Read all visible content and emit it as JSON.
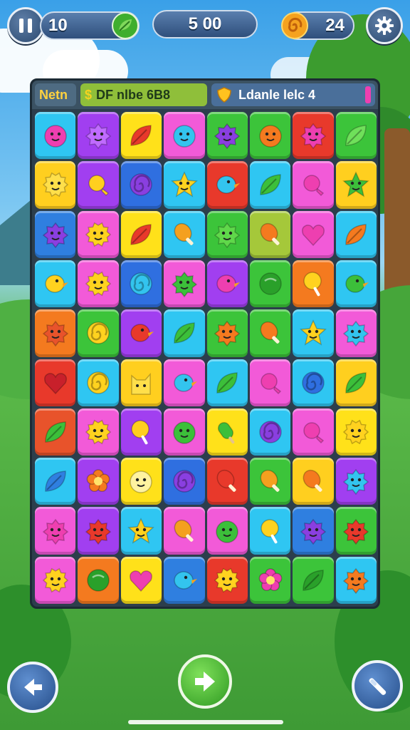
{
  "hud": {
    "moves": "10",
    "score": "5 00",
    "coins": "24"
  },
  "board_header": {
    "left_label": "Netn",
    "mid_label": "DF nlbe 6B8",
    "right_label": "Ldanle lelc 4"
  },
  "colors": {
    "red": "#e8392b",
    "orange": "#f47a1f",
    "yellow": "#ffd21f",
    "green": "#3cbf3a",
    "lime": "#8fd23a",
    "blue": "#2f7fe0",
    "cyan": "#33c4ee",
    "purple": "#8a3fe0",
    "pink": "#ee3fb0",
    "magenta": "#c83fe8"
  },
  "grid": [
    [
      {
        "color": "#2fc6f2",
        "icon": "blob-monster-icon",
        "ic": "#ee3fb0"
      },
      {
        "color": "#a13ff0",
        "icon": "spiky-monster-icon",
        "ic": "#c06bff"
      },
      {
        "color": "#ffe11a",
        "icon": "leaf-icon",
        "ic": "#e8392b"
      },
      {
        "color": "#f25ad8",
        "icon": "blob-monster-icon",
        "ic": "#33c4ee"
      },
      {
        "color": "#3cc43a",
        "icon": "spiky-monster-icon",
        "ic": "#8a3fe0"
      },
      {
        "color": "#3cc43a",
        "icon": "blob-monster-icon",
        "ic": "#f47a1f"
      },
      {
        "color": "#e8392b",
        "icon": "spiky-monster-icon",
        "ic": "#ee3fb0"
      },
      {
        "color": "#3cc43a",
        "icon": "leaf-icon",
        "ic": "#6fe05a"
      }
    ],
    [
      {
        "color": "#ffcf1f",
        "icon": "sun-icon",
        "ic": "#ffdf4a"
      },
      {
        "color": "#a13ff0",
        "icon": "candy-icon",
        "ic": "#ffcf1f"
      },
      {
        "color": "#2f6fe0",
        "icon": "swirl-icon",
        "ic": "#8a3fe0"
      },
      {
        "color": "#2fc6f2",
        "icon": "star-monster-icon",
        "ic": "#ffd21f"
      },
      {
        "color": "#e8392b",
        "icon": "bird-icon",
        "ic": "#33c4ee"
      },
      {
        "color": "#2fc6f2",
        "icon": "leaf-icon",
        "ic": "#3cbf3a"
      },
      {
        "color": "#f25ad8",
        "icon": "candy-icon",
        "ic": "#ee3fb0"
      },
      {
        "color": "#ffcf1f",
        "icon": "star-monster-icon",
        "ic": "#3cbf3a"
      }
    ],
    [
      {
        "color": "#2f7fe0",
        "icon": "spiky-monster-icon",
        "ic": "#8a3fe0"
      },
      {
        "color": "#f25ad8",
        "icon": "sun-icon",
        "ic": "#ffd21f"
      },
      {
        "color": "#ffe11a",
        "icon": "leaf-icon",
        "ic": "#e8392b"
      },
      {
        "color": "#2fc6f2",
        "icon": "drumstick-icon",
        "ic": "#f4a01f"
      },
      {
        "color": "#3cc43a",
        "icon": "spiky-monster-icon",
        "ic": "#5fd84a"
      },
      {
        "color": "#a5c83a",
        "icon": "drumstick-icon",
        "ic": "#f47a1f"
      },
      {
        "color": "#f25ad8",
        "icon": "heart-icon",
        "ic": "#ee3fb0"
      },
      {
        "color": "#2fc6f2",
        "icon": "leaf-icon",
        "ic": "#f47a1f"
      }
    ],
    [
      {
        "color": "#2fc6f2",
        "icon": "bird-icon",
        "ic": "#ffd21f"
      },
      {
        "color": "#f25ad8",
        "icon": "sun-icon",
        "ic": "#ffd21f"
      },
      {
        "color": "#2f6fe0",
        "icon": "swirl-icon",
        "ic": "#33c4ee"
      },
      {
        "color": "#f25ad8",
        "icon": "spiky-monster-icon",
        "ic": "#3cbf3a"
      },
      {
        "color": "#a13ff0",
        "icon": "bird-icon",
        "ic": "#ee3fb0"
      },
      {
        "color": "#3cc43a",
        "icon": "round-candy-icon",
        "ic": "#2aa02a"
      },
      {
        "color": "#f47a1f",
        "icon": "lollipop-icon",
        "ic": "#ffd21f"
      },
      {
        "color": "#2fc6f2",
        "icon": "bird-icon",
        "ic": "#3cbf3a"
      }
    ],
    [
      {
        "color": "#f47a1f",
        "icon": "spiky-monster-icon",
        "ic": "#e8532b"
      },
      {
        "color": "#3cc43a",
        "icon": "swirl-icon",
        "ic": "#ffd21f"
      },
      {
        "color": "#a13ff0",
        "icon": "bird-icon",
        "ic": "#e8392b"
      },
      {
        "color": "#2fc6f2",
        "icon": "leaf-icon",
        "ic": "#3cbf3a"
      },
      {
        "color": "#3cc43a",
        "icon": "spiky-monster-icon",
        "ic": "#f47a1f"
      },
      {
        "color": "#3cc43a",
        "icon": "drumstick-icon",
        "ic": "#f47a1f"
      },
      {
        "color": "#2fc6f2",
        "icon": "star-monster-icon",
        "ic": "#ffd21f"
      },
      {
        "color": "#f25ad8",
        "icon": "spiky-monster-icon",
        "ic": "#33c4ee"
      }
    ],
    [
      {
        "color": "#e8392b",
        "icon": "heart-icon",
        "ic": "#c8202b"
      },
      {
        "color": "#2fc6f2",
        "icon": "swirl-icon",
        "ic": "#ffd21f"
      },
      {
        "color": "#ffcf1f",
        "icon": "cat-icon",
        "ic": "#ffdf4a"
      },
      {
        "color": "#f25ad8",
        "icon": "bird-icon",
        "ic": "#33c4ee"
      },
      {
        "color": "#2fc6f2",
        "icon": "leaf-icon",
        "ic": "#3cbf3a"
      },
      {
        "color": "#f25ad8",
        "icon": "candy-icon",
        "ic": "#ee3fb0"
      },
      {
        "color": "#2fc6f2",
        "icon": "swirl-icon",
        "ic": "#2f6fe0"
      },
      {
        "color": "#ffcf1f",
        "icon": "leaf-icon",
        "ic": "#3cbf3a"
      }
    ],
    [
      {
        "color": "#e8532b",
        "icon": "leaf-icon",
        "ic": "#3cbf3a"
      },
      {
        "color": "#f25ad8",
        "icon": "sun-icon",
        "ic": "#ffd21f"
      },
      {
        "color": "#a13ff0",
        "icon": "lollipop-icon",
        "ic": "#ffcf1f"
      },
      {
        "color": "#f25ad8",
        "icon": "blob-monster-icon",
        "ic": "#3cbf3a"
      },
      {
        "color": "#ffe11a",
        "icon": "popsicle-icon",
        "ic": "#3cbf3a"
      },
      {
        "color": "#2fc6f2",
        "icon": "swirl-icon",
        "ic": "#8a3fe0"
      },
      {
        "color": "#f25ad8",
        "icon": "candy-icon",
        "ic": "#ee3fb0"
      },
      {
        "color": "#ffe11a",
        "icon": "sun-icon",
        "ic": "#ffd21f"
      }
    ],
    [
      {
        "color": "#2fc6f2",
        "icon": "leaf-icon",
        "ic": "#2f7fe0"
      },
      {
        "color": "#a13ff0",
        "icon": "flower-icon",
        "ic": "#f47a1f"
      },
      {
        "color": "#ffe11a",
        "icon": "blob-monster-icon",
        "ic": "#fff3a0"
      },
      {
        "color": "#2f6fe0",
        "icon": "swirl-icon",
        "ic": "#8a3fe0"
      },
      {
        "color": "#e8392b",
        "icon": "drumstick-icon",
        "ic": "#e8392b"
      },
      {
        "color": "#3cc43a",
        "icon": "drumstick-icon",
        "ic": "#f4a01f"
      },
      {
        "color": "#ffcf1f",
        "icon": "drumstick-icon",
        "ic": "#f47a1f"
      },
      {
        "color": "#a13ff0",
        "icon": "spiky-monster-icon",
        "ic": "#33c4ee"
      }
    ],
    [
      {
        "color": "#f25ad8",
        "icon": "spiky-monster-icon",
        "ic": "#ee3fb0"
      },
      {
        "color": "#a13ff0",
        "icon": "spiky-monster-icon",
        "ic": "#e8392b"
      },
      {
        "color": "#2fc6f2",
        "icon": "star-monster-icon",
        "ic": "#ffd21f"
      },
      {
        "color": "#f25ad8",
        "icon": "drumstick-icon",
        "ic": "#f4a01f"
      },
      {
        "color": "#f25ad8",
        "icon": "blob-monster-icon",
        "ic": "#3cbf3a"
      },
      {
        "color": "#2fc6f2",
        "icon": "lollipop-icon",
        "ic": "#ffd21f"
      },
      {
        "color": "#2f7fe0",
        "icon": "spiky-monster-icon",
        "ic": "#8a3fe0"
      },
      {
        "color": "#3cc43a",
        "icon": "spiky-monster-icon",
        "ic": "#e8392b"
      }
    ],
    [
      {
        "color": "#f25ad8",
        "icon": "sun-icon",
        "ic": "#ffd21f"
      },
      {
        "color": "#f47a1f",
        "icon": "round-candy-icon",
        "ic": "#2aa02a"
      },
      {
        "color": "#ffe11a",
        "icon": "heart-icon",
        "ic": "#ee3fb0"
      },
      {
        "color": "#2f7fe0",
        "icon": "bird-icon",
        "ic": "#33c4ee"
      },
      {
        "color": "#e8392b",
        "icon": "sun-icon",
        "ic": "#ffd21f"
      },
      {
        "color": "#3cc43a",
        "icon": "flower-icon",
        "ic": "#ee3fb0"
      },
      {
        "color": "#3cc43a",
        "icon": "leaf-icon",
        "ic": "#2aa02a"
      },
      {
        "color": "#2fc6f2",
        "icon": "spiky-monster-icon",
        "ic": "#f47a1f"
      }
    ]
  ]
}
